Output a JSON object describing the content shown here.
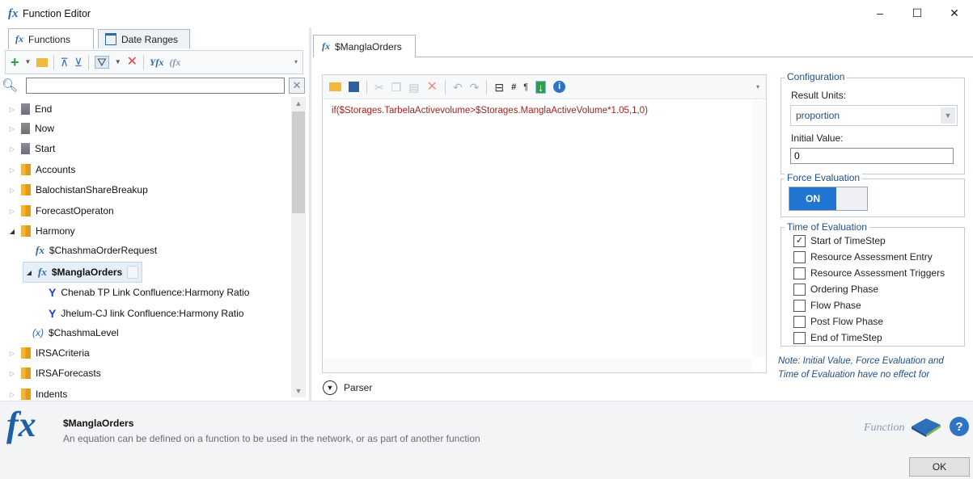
{
  "window": {
    "title": "Function Editor",
    "controls": {
      "minimize": "–",
      "maximize": "☐",
      "close": "✕"
    }
  },
  "left_tabs": [
    {
      "label": "Functions",
      "active": true
    },
    {
      "label": "Date Ranges",
      "active": false
    }
  ],
  "left_toolbar": {
    "icons": [
      "add-icon",
      "open-folder-icon",
      "collapse-all-icon",
      "expand-all-icon",
      "filter-icon",
      "delete-icon",
      "function-slot-icon",
      "function-disabled-icon"
    ]
  },
  "search": {
    "value": "",
    "placeholder": ""
  },
  "tree": [
    {
      "label": "End",
      "kind": "folder-gray",
      "expanded": false
    },
    {
      "label": "Now",
      "kind": "folder-gray",
      "expanded": false
    },
    {
      "label": "Start",
      "kind": "folder-gray",
      "expanded": false
    },
    {
      "label": "Accounts",
      "kind": "folder",
      "expanded": false
    },
    {
      "label": "BalochistanShareBreakup",
      "kind": "folder",
      "expanded": false
    },
    {
      "label": "ForecastOperaton",
      "kind": "folder",
      "expanded": false
    },
    {
      "label": "Harmony",
      "kind": "folder",
      "expanded": true
    },
    {
      "label": "$ChashmaOrderRequest",
      "kind": "function"
    },
    {
      "label": "$ManglaOrders",
      "kind": "function",
      "selected": true
    },
    {
      "label": "Chenab TP Link Confluence:Harmony Ratio",
      "kind": "slot"
    },
    {
      "label": "Jhelum-CJ link Confluence:Harmony Ratio",
      "kind": "slot"
    },
    {
      "label": "$ChashmaLevel",
      "kind": "variable"
    },
    {
      "label": "IRSACriteria",
      "kind": "folder",
      "expanded": false
    },
    {
      "label": "IRSAForecasts",
      "kind": "folder",
      "expanded": false
    },
    {
      "label": "Indents",
      "kind": "folder",
      "expanded": false
    }
  ],
  "editor": {
    "tab_label": "$ManglaOrders",
    "toolbar_icons": [
      "open-icon",
      "save-icon",
      "cut-icon",
      "copy-icon",
      "paste-icon",
      "delete-icon",
      "undo-icon",
      "redo-icon",
      "wrap-icon",
      "hash-icon",
      "pilcrow-icon",
      "insert-icon",
      "info-icon"
    ],
    "expression": "if($Storages.TarbelaActivevolume>$Storages.ManglaActiveVolume*1.05,1,0)",
    "parser_label": "Parser"
  },
  "configuration": {
    "title": "Configuration",
    "result_units_label": "Result Units:",
    "result_units_value": "proportion",
    "initial_value_label": "Initial Value:",
    "initial_value": "0"
  },
  "force_evaluation": {
    "title": "Force Evaluation",
    "state": "ON"
  },
  "time_of_evaluation": {
    "title": "Time of Evaluation",
    "options": [
      {
        "label": "Start of TimeStep",
        "checked": true
      },
      {
        "label": "Resource Assessment Entry",
        "checked": false
      },
      {
        "label": "Resource Assessment Triggers",
        "checked": false
      },
      {
        "label": "Ordering Phase",
        "checked": false
      },
      {
        "label": "Flow Phase",
        "checked": false
      },
      {
        "label": "Post Flow Phase",
        "checked": false
      },
      {
        "label": "End of TimeStep",
        "checked": false
      }
    ]
  },
  "note": "Note: Initial Value, Force Evaluation and Time of Evaluation have no effect for",
  "info": {
    "name": "$ManglaOrders",
    "description": "An equation can be defined on a function to be used in the network, or as part of another function",
    "type_label": "Function"
  },
  "footer": {
    "ok_label": "OK"
  },
  "colors": {
    "accent": "#2176d2",
    "link_blue": "#1f4e8a",
    "expression_red": "#a0241f"
  }
}
